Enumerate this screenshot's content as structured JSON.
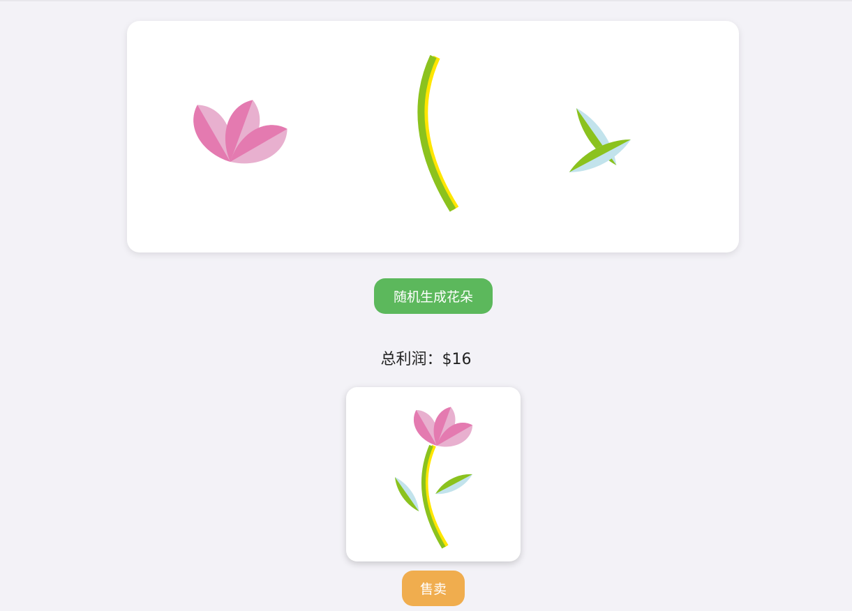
{
  "parts_panel": {
    "parts": [
      {
        "name": "flower-head",
        "icon": "flower-head-icon"
      },
      {
        "name": "stem",
        "icon": "stem-icon"
      },
      {
        "name": "leaves",
        "icon": "leaves-icon"
      }
    ]
  },
  "generate_button": {
    "label": "随机生成花朵"
  },
  "profit": {
    "text": "总利润：$16"
  },
  "flower_card": {
    "icon": "flower-icon"
  },
  "sell_button": {
    "label": "售卖"
  },
  "colors": {
    "background": "#f3f2f7",
    "panel": "#ffffff",
    "generate_button": "#5cb85c",
    "sell_button": "#f0ad4e",
    "petal_dark": "#e47ab0",
    "petal_light": "#e8b0cf",
    "stem_green": "#8bc21e",
    "stem_yellow": "#ffe600",
    "leaf_green": "#8bc21e",
    "leaf_blue": "#c2e3ec"
  }
}
